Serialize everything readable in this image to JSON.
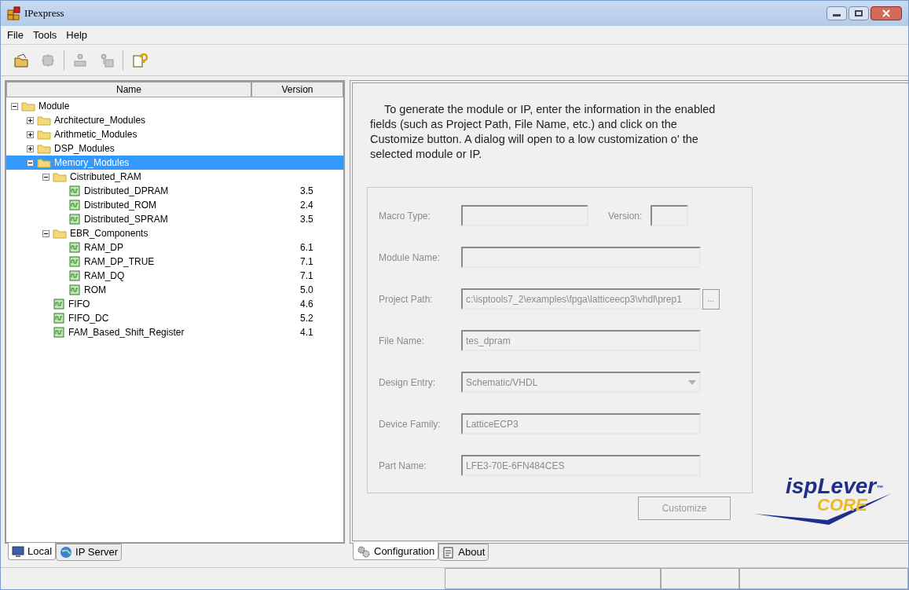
{
  "window": {
    "title": "IPexpress"
  },
  "menu": [
    "File",
    "Tools",
    "Help"
  ],
  "toolbar": [
    {
      "kind": "open",
      "disabled": false
    },
    {
      "kind": "chip",
      "disabled": true
    },
    {
      "kind": "export",
      "disabled": true
    },
    {
      "kind": "import",
      "disabled": true
    },
    {
      "kind": "help",
      "disabled": false
    }
  ],
  "tree": {
    "columns": [
      "Name",
      "Version"
    ],
    "items": [
      {
        "name": "Module",
        "kind": "folder",
        "expanded": true,
        "selected": false,
        "children": [
          {
            "name": "Architecture_Modules",
            "kind": "folder",
            "expanded": false,
            "selected": false
          },
          {
            "name": "Arithmetic_Modules",
            "kind": "folder",
            "expanded": false,
            "selected": false
          },
          {
            "name": "DSP_Modules",
            "kind": "folder",
            "expanded": false,
            "selected": false
          },
          {
            "name": "Memory_Modules",
            "kind": "folder",
            "expanded": true,
            "selected": true,
            "children": [
              {
                "name": "Cistributed_RAM",
                "kind": "folder",
                "expanded": true,
                "selected": false,
                "children": [
                  {
                    "name": "Distributed_DPRAM",
                    "kind": "module",
                    "version": "3.5",
                    "selected": false
                  },
                  {
                    "name": "Distributed_ROM",
                    "kind": "module",
                    "version": "2.4",
                    "selected": false
                  },
                  {
                    "name": "Distributed_SPRAM",
                    "kind": "module",
                    "version": "3.5",
                    "selected": false
                  }
                ]
              },
              {
                "name": "EBR_Components",
                "kind": "folder",
                "expanded": true,
                "selected": false,
                "children": [
                  {
                    "name": "RAM_DP",
                    "kind": "module",
                    "version": "6.1",
                    "selected": false
                  },
                  {
                    "name": "RAM_DP_TRUE",
                    "kind": "module",
                    "version": "7.1",
                    "selected": false
                  },
                  {
                    "name": "RAM_DQ",
                    "kind": "module",
                    "version": "7.1",
                    "selected": false
                  },
                  {
                    "name": "ROM",
                    "kind": "module",
                    "version": "5.0",
                    "selected": false
                  }
                ]
              },
              {
                "name": "FIFO",
                "kind": "module",
                "version": "4.6",
                "selected": false
              },
              {
                "name": "FIFO_DC",
                "kind": "module",
                "version": "5.2",
                "selected": false
              },
              {
                "name": "FAM_Based_Shift_Register",
                "kind": "module",
                "version": "4.1",
                "selected": false
              }
            ]
          }
        ]
      }
    ]
  },
  "left_tabs": [
    {
      "label": "Local",
      "kind": "computer",
      "selected": true
    },
    {
      "label": "IP Server",
      "kind": "globe",
      "selected": false
    }
  ],
  "intro": "To generate the module or IP, enter the information in the enabled fields (such as Project Path, File Name, etc.) and click on the Customize button. A dialog will open to a low customization o' the selected module or IP.",
  "form": [
    {
      "label": "Macro Type:",
      "kind": "text",
      "disabled": true,
      "extra": {
        "label": "Version:"
      }
    },
    {
      "label": "Module Name:",
      "kind": "text",
      "disabled": true
    },
    {
      "label": "Project Path:",
      "kind": "browse",
      "value": "c:\\isptools7_2\\examples\\fpga\\latticeecp3\\vhdl\\prep1",
      "button": "...",
      "disabled": true
    },
    {
      "label": "File Name:",
      "kind": "text",
      "value": "tes_dpram",
      "disabled": true
    },
    {
      "label": "Design Entry:",
      "kind": "combo",
      "value": "Schematic/VHDL",
      "disabled": true
    },
    {
      "label": "Device Family:",
      "kind": "text",
      "value": "LatticeECP3",
      "disabled": true
    },
    {
      "label": "Part Name:",
      "kind": "text",
      "value": "LFE3-70E-6FN484CES",
      "disabled": true
    }
  ],
  "customize_button": {
    "label": "Customize",
    "disabled": true
  },
  "logo": {
    "line1": "ispLever",
    "mark": "™",
    "line2": "CORE"
  },
  "right_tabs": [
    {
      "label": "Configuration",
      "kind": "gears",
      "selected": true
    },
    {
      "label": "About",
      "kind": "notes",
      "selected": false
    }
  ]
}
